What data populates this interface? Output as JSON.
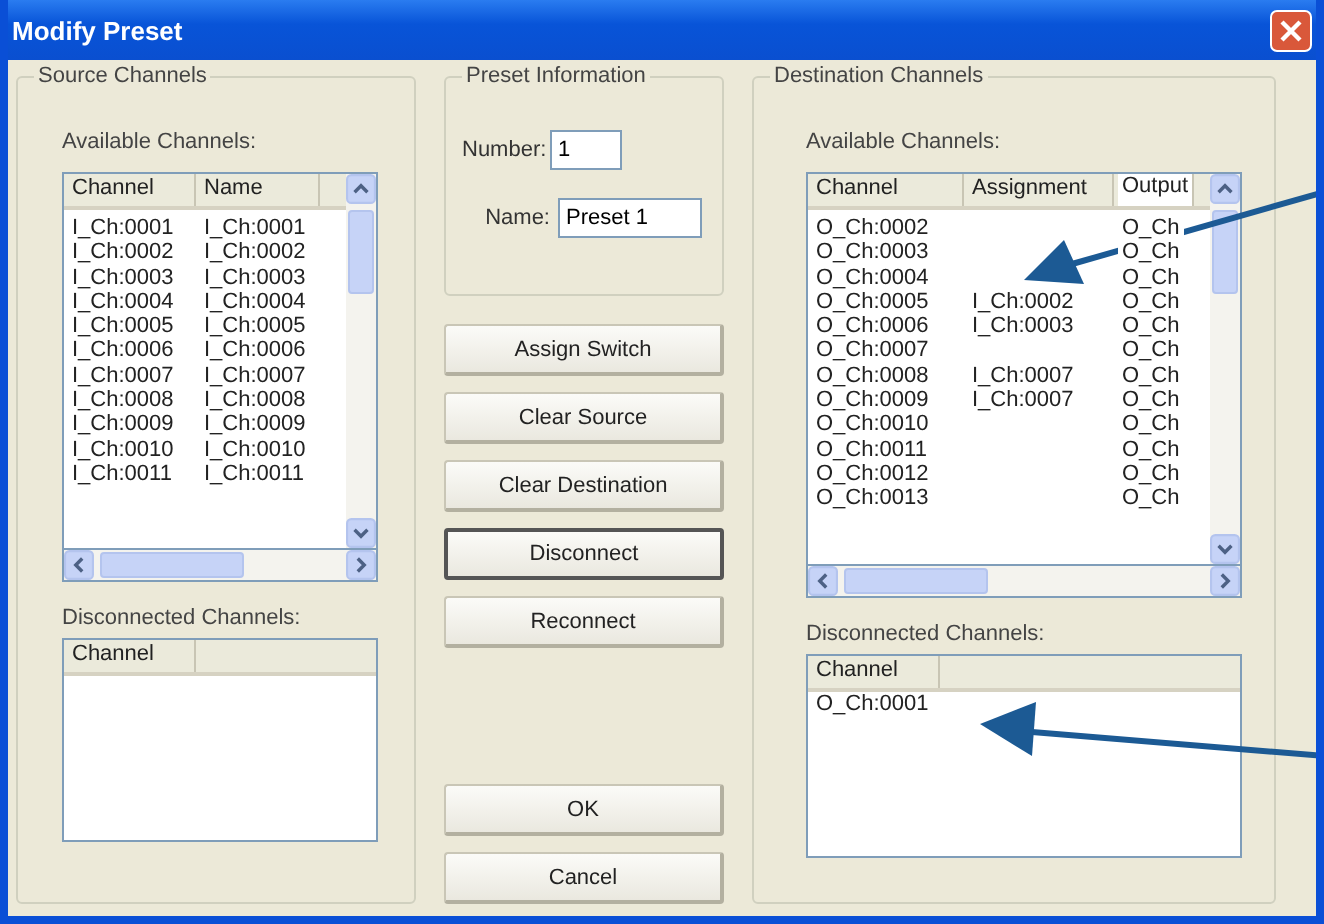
{
  "window": {
    "title": "Modify Preset"
  },
  "source": {
    "title": "Source Channels",
    "available_label": "Available Channels:",
    "columns": [
      "Channel",
      "Name"
    ],
    "rows": [
      [
        "I_Ch:0001",
        "I_Ch:0001"
      ],
      [
        "I_Ch:0002",
        "I_Ch:0002"
      ],
      [
        "I_Ch:0003",
        "I_Ch:0003"
      ],
      [
        "I_Ch:0004",
        "I_Ch:0004"
      ],
      [
        "I_Ch:0005",
        "I_Ch:0005"
      ],
      [
        "I_Ch:0006",
        "I_Ch:0006"
      ],
      [
        "I_Ch:0007",
        "I_Ch:0007"
      ],
      [
        "I_Ch:0008",
        "I_Ch:0008"
      ],
      [
        "I_Ch:0009",
        "I_Ch:0009"
      ],
      [
        "I_Ch:0010",
        "I_Ch:0010"
      ],
      [
        "I_Ch:0011",
        "I_Ch:0011"
      ]
    ],
    "disconnected_label": "Disconnected Channels:",
    "disconnected_columns": [
      "Channel"
    ]
  },
  "preset": {
    "title": "Preset Information",
    "number_label": "Number:",
    "number": "1",
    "name_label": "Name:",
    "name": "Preset 1"
  },
  "buttons": [
    {
      "label": "Assign Switch",
      "focused": false
    },
    {
      "label": "Clear Source",
      "focused": false
    },
    {
      "label": "Clear Destination",
      "focused": false
    },
    {
      "label": "Disconnect",
      "focused": true
    },
    {
      "label": "Reconnect",
      "focused": false
    }
  ],
  "dialog_buttons": [
    {
      "label": "OK",
      "focused": false
    },
    {
      "label": "Cancel",
      "focused": false
    }
  ],
  "destination": {
    "title": "Destination Channels",
    "available_label": "Available Channels:",
    "columns": [
      "Channel",
      "Assignment",
      "Output"
    ],
    "rows": [
      [
        "O_Ch:0002",
        "",
        "O_Ch"
      ],
      [
        "O_Ch:0003",
        "",
        "O_Ch"
      ],
      [
        "O_Ch:0004",
        "",
        "O_Ch"
      ],
      [
        "O_Ch:0005",
        "I_Ch:0002",
        "O_Ch"
      ],
      [
        "O_Ch:0006",
        "I_Ch:0003",
        "O_Ch"
      ],
      [
        "O_Ch:0007",
        "",
        "O_Ch"
      ],
      [
        "O_Ch:0008",
        "I_Ch:0007",
        "O_Ch"
      ],
      [
        "O_Ch:0009",
        "I_Ch:0007",
        "O_Ch"
      ],
      [
        "O_Ch:0010",
        "",
        "O_Ch"
      ],
      [
        "O_Ch:0011",
        "",
        "O_Ch"
      ],
      [
        "O_Ch:0012",
        "",
        "O_Ch"
      ],
      [
        "O_Ch:0013",
        "",
        "O_Ch"
      ]
    ],
    "disconnected_label": "Disconnected Channels:",
    "disconnected_columns": [
      "Channel"
    ],
    "disconnected_rows": [
      [
        "O_Ch:0001"
      ]
    ]
  }
}
